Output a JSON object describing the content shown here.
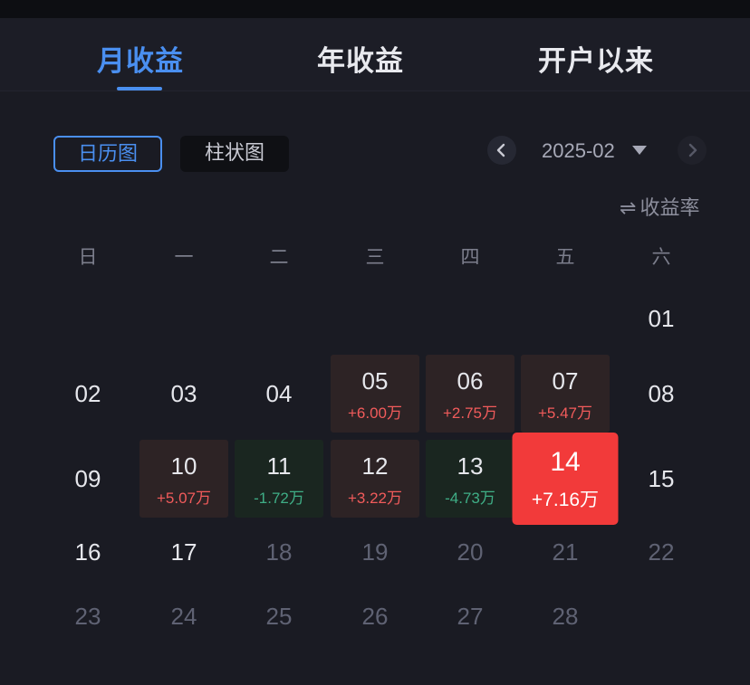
{
  "tabs": [
    {
      "label": "月收益",
      "active": true
    },
    {
      "label": "年收益",
      "active": false
    },
    {
      "label": "开户以来",
      "active": false
    }
  ],
  "view_toggle": {
    "calendar": "日历图",
    "bar": "柱状图"
  },
  "month_selector": {
    "value": "2025-02"
  },
  "metric_switch": {
    "icon": "⇌",
    "label": "收益率"
  },
  "weekdays": [
    "日",
    "一",
    "二",
    "三",
    "四",
    "五",
    "六"
  ],
  "days": {
    "01": {
      "num": "01"
    },
    "02": {
      "num": "02"
    },
    "03": {
      "num": "03"
    },
    "04": {
      "num": "04"
    },
    "05": {
      "num": "05",
      "amount": "+6.00万"
    },
    "06": {
      "num": "06",
      "amount": "+2.75万"
    },
    "07": {
      "num": "07",
      "amount": "+5.47万"
    },
    "08": {
      "num": "08"
    },
    "09": {
      "num": "09"
    },
    "10": {
      "num": "10",
      "amount": "+5.07万"
    },
    "11": {
      "num": "11",
      "amount": "-1.72万"
    },
    "12": {
      "num": "12",
      "amount": "+3.22万"
    },
    "13": {
      "num": "13",
      "amount": "-4.73万"
    },
    "14": {
      "num": "14",
      "amount": "+7.16万"
    },
    "15": {
      "num": "15"
    },
    "16": {
      "num": "16"
    },
    "17": {
      "num": "17"
    },
    "18": {
      "num": "18"
    },
    "19": {
      "num": "19"
    },
    "20": {
      "num": "20"
    },
    "21": {
      "num": "21"
    },
    "22": {
      "num": "22"
    },
    "23": {
      "num": "23"
    },
    "24": {
      "num": "24"
    },
    "25": {
      "num": "25"
    },
    "26": {
      "num": "26"
    },
    "27": {
      "num": "27"
    },
    "28": {
      "num": "28"
    }
  },
  "colors": {
    "accent": "#4a8ff0",
    "gain_text": "#f15b5b",
    "loss_text": "#3fae86",
    "selected_bg": "#f23a3a",
    "background": "#1a1b23"
  }
}
